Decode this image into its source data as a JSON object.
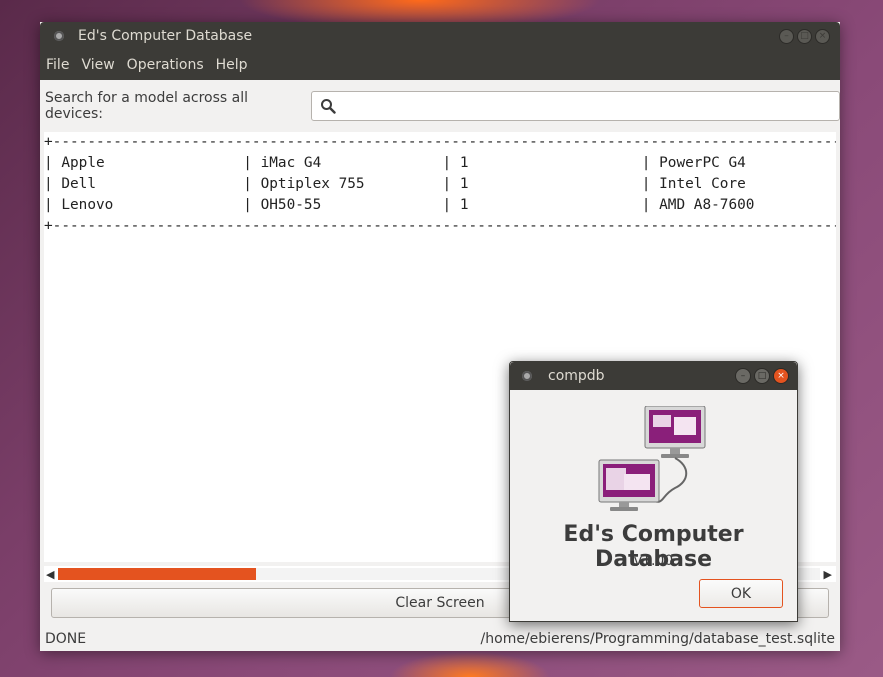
{
  "window": {
    "title": "Ed's Computer Database",
    "controls": [
      "minimize-icon",
      "maximize-icon",
      "close-icon"
    ]
  },
  "menu": {
    "items": [
      {
        "label": "File"
      },
      {
        "label": "View"
      },
      {
        "label": "Operations"
      },
      {
        "label": "Help"
      }
    ]
  },
  "search": {
    "label": "Search for a model across all devices:",
    "value": "",
    "icon": "search-icon"
  },
  "output": {
    "lines": [
      "+------------------------------------------------------------------------------------------------------------",
      "| Apple                | iMac G4              | 1                    | PowerPC G4",
      "| Dell                 | Optiplex 755         | 1                    | Intel Core",
      "| Lenovo               | OH50-55              | 1                    | AMD A8-7600",
      "+------------------------------------------------------------------------------------------------------------"
    ],
    "scroll_position": 0.0,
    "scroll_visible_fraction": 0.26
  },
  "buttons": {
    "clear_label": "Clear Screen"
  },
  "status": {
    "state": "DONE",
    "path": "/home/ebierens/Programming/database_test.sqlite"
  },
  "dialog": {
    "title": "compdb",
    "app_name": "Ed's Computer Database",
    "version": "v1.00",
    "ok_label": "OK",
    "icon": "network-computers-icon"
  },
  "colors": {
    "accent": "#e4531f",
    "titlebar": "#3c3b37",
    "window_bg": "#f2f1f0",
    "icon_purple": "#8a1f7a"
  }
}
